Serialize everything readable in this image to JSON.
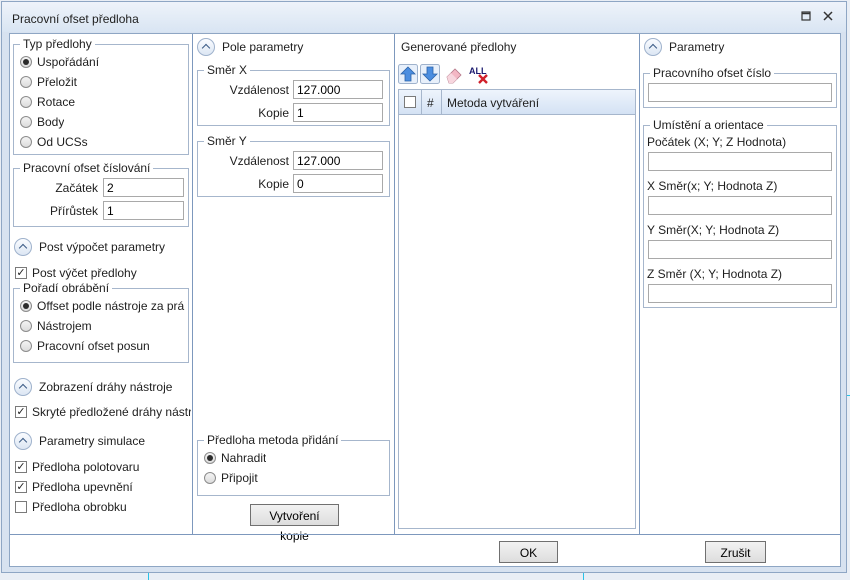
{
  "window": {
    "title": "Pracovní ofset předloha",
    "restore_icon": "restore-icon",
    "close_icon": "close-icon"
  },
  "col1": {
    "typ": {
      "legend": "Typ předlohy",
      "options": [
        {
          "label": "Uspořádání",
          "checked": true
        },
        {
          "label": "Přeložit",
          "checked": false
        },
        {
          "label": "Rotace",
          "checked": false
        },
        {
          "label": "Body",
          "checked": false
        },
        {
          "label": "Od UCSs",
          "checked": false
        }
      ]
    },
    "cislovani": {
      "legend": "Pracovní ofset číslování",
      "start_label": "Začátek",
      "start_value": "2",
      "step_label": "Přírůstek",
      "step_value": "1"
    },
    "post": {
      "title": "Post výpočet parametry",
      "check_label": "Post výčet předlohy",
      "checked": true
    },
    "porad": {
      "legend": "Pořadí obrábění",
      "options": [
        {
          "label": "Offset podle nástroje za prá",
          "checked": true
        },
        {
          "label": "Nástrojem",
          "checked": false
        },
        {
          "label": "Pracovní ofset posun",
          "checked": false
        }
      ]
    },
    "zobrazeni": {
      "title": "Zobrazení dráhy nástroje",
      "check_label": "Skryté předložené dráhy nástr",
      "checked": true
    },
    "simulace": {
      "title": "Parametry simulace",
      "checks": [
        {
          "label": "Předloha polotovaru",
          "checked": true
        },
        {
          "label": "Předloha upevnění",
          "checked": true
        },
        {
          "label": "Předloha obrobku",
          "checked": false
        }
      ]
    }
  },
  "col2": {
    "title": "Pole parametry",
    "smer_x": {
      "legend": "Směr X",
      "dist_label": "Vzdálenost",
      "dist_value": "127.000",
      "copies_label": "Kopie",
      "copies_value": "1"
    },
    "smer_y": {
      "legend": "Směr Y",
      "dist_label": "Vzdálenost",
      "dist_value": "127.000",
      "copies_label": "Kopie",
      "copies_value": "0"
    },
    "metoda": {
      "legend": "Předloha metoda přidání",
      "options": [
        {
          "label": "Nahradit",
          "checked": true
        },
        {
          "label": "Připojit",
          "checked": false
        }
      ]
    },
    "create_copy_button": "Vytvoření kopie"
  },
  "col3": {
    "title": "Generované předlohy",
    "toolbar": [
      "move-up-icon",
      "move-down-icon",
      "eraser-icon",
      "delete-all-icon"
    ],
    "all_icon_text": "ALL",
    "grid": {
      "col_hash": "#",
      "col_method": "Metoda vytváření"
    }
  },
  "col4": {
    "title": "Parametry",
    "ofset_cislo": {
      "legend": "Pracovního ofset číslo",
      "value": ""
    },
    "umisteni": {
      "legend": "Umístění a orientace",
      "fields": [
        {
          "label": "Počátek (X; Y; Z Hodnota)",
          "value": ""
        },
        {
          "label": "X Směr(x; Y; Hodnota Z)",
          "value": ""
        },
        {
          "label": "Y Směr(X; Y; Hodnota Z)",
          "value": ""
        },
        {
          "label": "Z Směr (X; Y; Hodnota Z)",
          "value": ""
        }
      ]
    }
  },
  "footer": {
    "ok": "OK",
    "cancel": "Zrušit"
  },
  "colors": {
    "accent": "#3d7fd6",
    "header_blue": "#d4e2f4",
    "border": "#7d98bd"
  }
}
